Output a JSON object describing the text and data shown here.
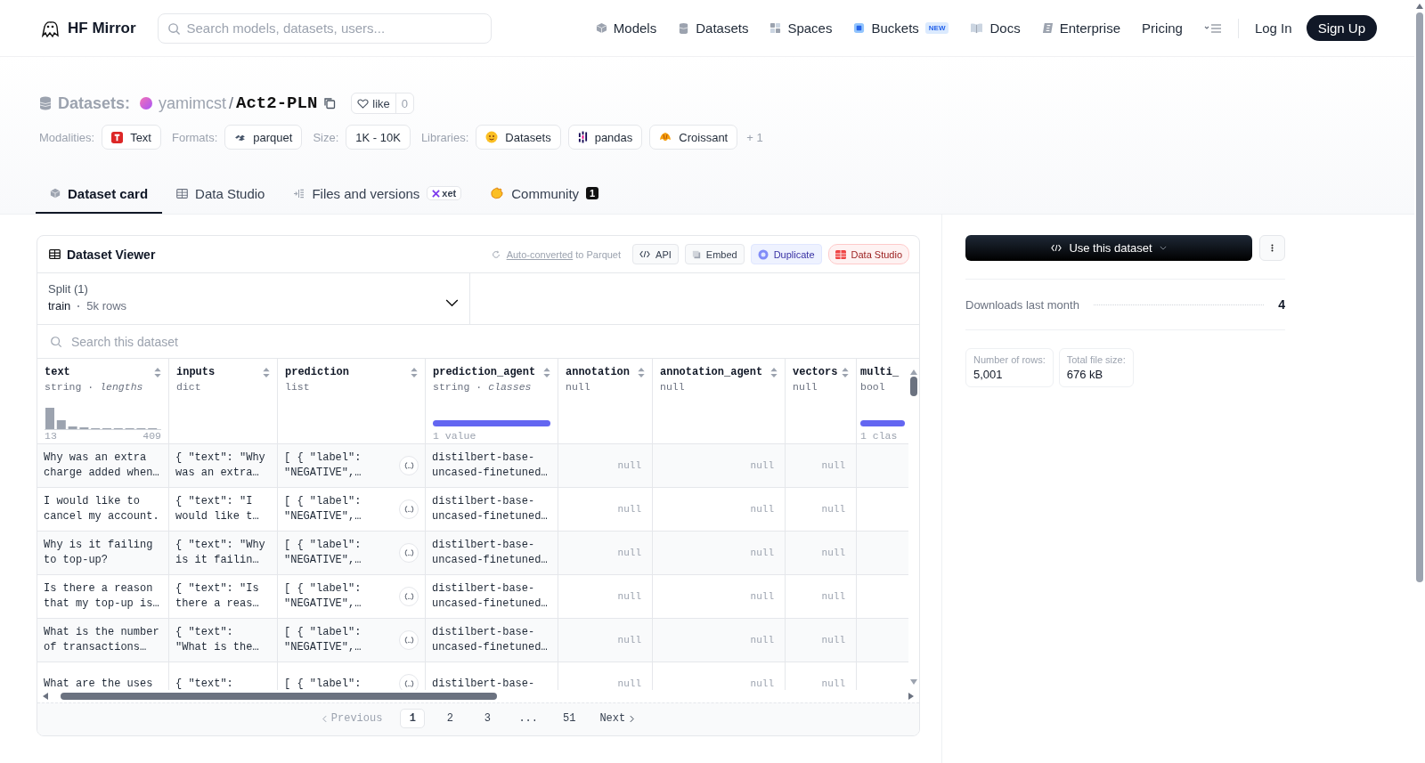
{
  "header": {
    "brand": "HF Mirror",
    "search": {
      "placeholder": "Search models, datasets, users..."
    },
    "nav": [
      {
        "label": "Models"
      },
      {
        "label": "Datasets"
      },
      {
        "label": "Spaces"
      },
      {
        "label": "Buckets",
        "badge": "NEW"
      },
      {
        "label": "Docs"
      },
      {
        "label": "Enterprise"
      },
      {
        "label": "Pricing"
      }
    ],
    "login": "Log In",
    "signup": "Sign Up"
  },
  "repo": {
    "type": "Datasets:",
    "owner": "yamimcst",
    "separator": "/",
    "name": "Act2-PLN",
    "like": "like",
    "likes": "0"
  },
  "tag_groups": [
    {
      "label": "Modalities:",
      "tags": [
        "Text"
      ]
    },
    {
      "label": "Formats:",
      "tags": [
        "parquet"
      ]
    },
    {
      "label": "Size:",
      "tags": [
        "1K - 10K"
      ]
    },
    {
      "label": "Libraries:",
      "tags": [
        "Datasets",
        "pandas",
        "Croissant"
      ]
    }
  ],
  "more_tags": "+ 1",
  "tabs": [
    {
      "label": "Dataset card",
      "selected": true
    },
    {
      "label": "Data Studio",
      "selected": false
    },
    {
      "label": "Files and versions",
      "selected": false,
      "badge": "xet"
    },
    {
      "label": "Community",
      "selected": false,
      "count": "1"
    }
  ],
  "viewer": {
    "title": "Dataset Viewer",
    "conversion": {
      "link": "Auto-converted",
      "text": "to Parquet"
    },
    "actions": [
      {
        "label": "API",
        "kind": "plain"
      },
      {
        "label": "Embed",
        "kind": "plain"
      },
      {
        "label": "Duplicate",
        "kind": "accent"
      },
      {
        "label": "Data Studio",
        "kind": "studio"
      }
    ],
    "split": {
      "label": "Split (1)",
      "name": "train",
      "rows": "5k rows"
    },
    "search": {
      "placeholder": "Search this dataset"
    },
    "columns": [
      {
        "name": "text",
        "type": "string · *lengths*",
        "kind": "string",
        "min": "13",
        "max": "409"
      },
      {
        "name": "inputs",
        "type": "dict",
        "kind": "dict"
      },
      {
        "name": "prediction",
        "type": "list",
        "kind": "list"
      },
      {
        "name": "prediction_agent",
        "type": "string · *classes*",
        "kind": "string",
        "note": "1 value"
      },
      {
        "name": "annotation",
        "type": "null",
        "kind": "null"
      },
      {
        "name": "annotation_agent",
        "type": "null",
        "kind": "null"
      },
      {
        "name": "vectors",
        "type": "null",
        "kind": "null"
      },
      {
        "name": "multi_",
        "type": "bool",
        "kind": "bool",
        "note": "1 clas"
      }
    ],
    "rows": [
      {
        "cells": [
          [
            "Why was an extra",
            "charge added when…"
          ],
          [
            "{ \"text\": \"Why",
            "was an extra…"
          ],
          [
            "[ { \"label\":",
            "\"NEGATIVE\",…"
          ],
          [
            "distilbert-base-",
            "uncased-finetuned…"
          ],
          [
            "null"
          ],
          [
            "null"
          ],
          [
            "null"
          ]
        ]
      },
      {
        "cells": [
          [
            "I would like to",
            "cancel my account."
          ],
          [
            "{ \"text\": \"I",
            "would like t…"
          ],
          [
            "[ { \"label\":",
            "\"NEGATIVE\",…"
          ],
          [
            "distilbert-base-",
            "uncased-finetuned…"
          ],
          [
            "null"
          ],
          [
            "null"
          ],
          [
            "null"
          ]
        ]
      },
      {
        "cells": [
          [
            "Why is it failing",
            "to top-up?"
          ],
          [
            "{ \"text\": \"Why",
            "is it failin…"
          ],
          [
            "[ { \"label\":",
            "\"NEGATIVE\",…"
          ],
          [
            "distilbert-base-",
            "uncased-finetuned…"
          ],
          [
            "null"
          ],
          [
            "null"
          ],
          [
            "null"
          ]
        ]
      },
      {
        "cells": [
          [
            "Is there a reason",
            "that my top-up is…"
          ],
          [
            "{ \"text\": \"Is",
            "there a reas…"
          ],
          [
            "[ { \"label\":",
            "\"NEGATIVE\",…"
          ],
          [
            "distilbert-base-",
            "uncased-finetuned…"
          ],
          [
            "null"
          ],
          [
            "null"
          ],
          [
            "null"
          ]
        ]
      },
      {
        "cells": [
          [
            "What is the number",
            "of transactions…"
          ],
          [
            "{ \"text\":",
            "\"What is the…"
          ],
          [
            "[ { \"label\":",
            "\"NEGATIVE\",…"
          ],
          [
            "distilbert-base-",
            "uncased-finetuned…"
          ],
          [
            "null"
          ],
          [
            "null"
          ],
          [
            "null"
          ]
        ]
      },
      {
        "cells": [
          [
            "What are the uses"
          ],
          [
            "{ \"text\":"
          ],
          [
            "[ { \"label\":"
          ],
          [
            "distilbert-base-"
          ],
          [
            "null"
          ],
          [
            "null"
          ],
          [
            "null"
          ]
        ]
      }
    ],
    "pagination": {
      "previous": {
        "label": "Previous",
        "disabled": true
      },
      "pages": [
        {
          "label": "1",
          "selected": true
        },
        {
          "label": "2",
          "selected": false
        },
        {
          "label": "3",
          "selected": false
        },
        {
          "label": "...",
          "selected": false
        },
        {
          "label": "51",
          "selected": false
        }
      ],
      "next": {
        "label": "Next",
        "disabled": false
      }
    }
  },
  "sidebar": {
    "use_button": "Use this dataset",
    "downloads": {
      "label": "Downloads last month",
      "value": "4"
    },
    "stats": [
      {
        "label": "Number of rows:",
        "value": "5,001"
      },
      {
        "label": "Total file size:",
        "value": "676 kB"
      }
    ]
  }
}
